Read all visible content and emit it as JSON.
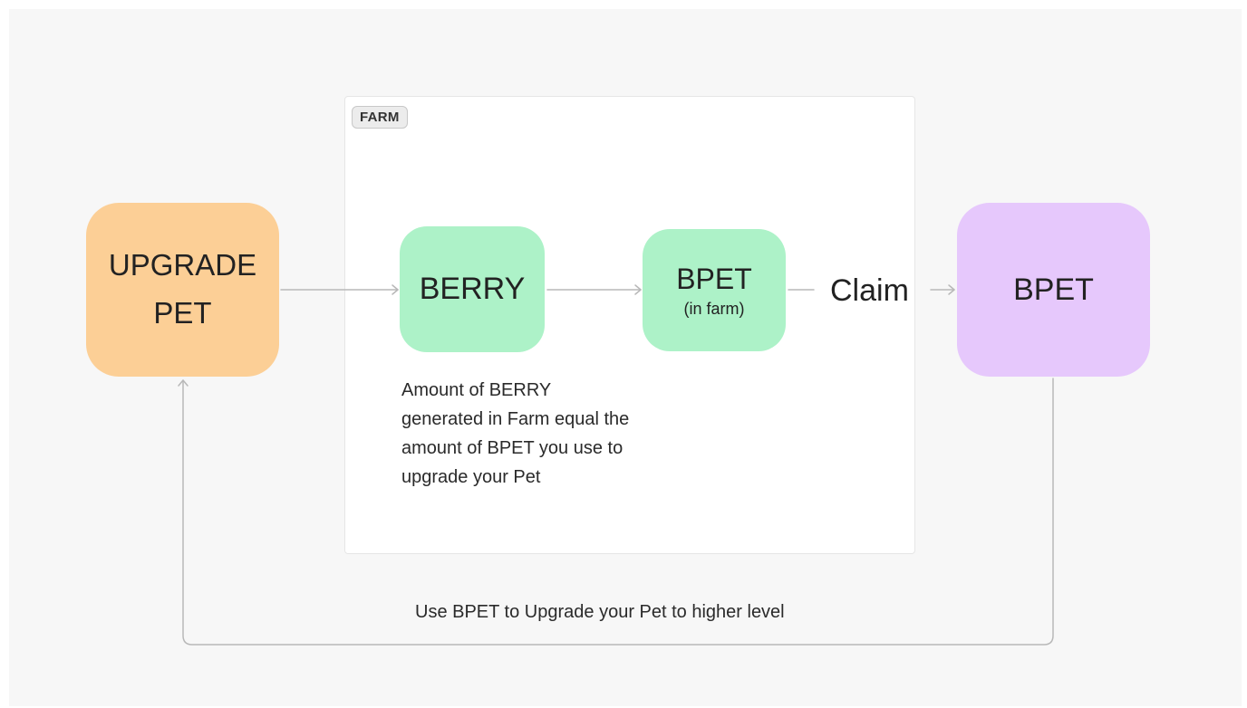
{
  "frame": {
    "tag": "FARM"
  },
  "nodes": {
    "upgrade_pet": {
      "line1": "UPGRADE",
      "line2": "PET"
    },
    "berry": {
      "label": "BERRY"
    },
    "bpet_farm": {
      "label": "BPET",
      "sublabel": "(in farm)"
    },
    "bpet": {
      "label": "BPET"
    }
  },
  "edges": {
    "claim_label": "Claim",
    "loop_label": "Use BPET to Upgrade your Pet to higher level"
  },
  "notes": {
    "berry_note": "Amount of BERRY generated in Farm equal the amount of BPET you use to upgrade your Pet"
  },
  "colors": {
    "upgrade_pet": "#fccf96",
    "berry": "#adf2c8",
    "bpet_farm": "#adf2c8",
    "bpet": "#e6c8fc",
    "connector": "#b8b8b8"
  }
}
